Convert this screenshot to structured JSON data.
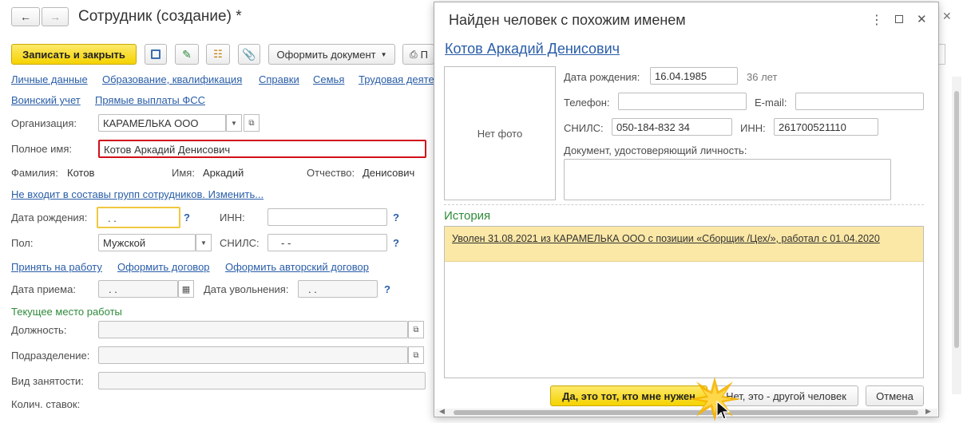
{
  "window": {
    "title": "Сотрудник (создание) *",
    "close_glyph": "✕"
  },
  "toolbar": {
    "save_close": "Записать и закрыть",
    "document": "Оформить документ",
    "print_partial": "П"
  },
  "links_row1": [
    "Личные данные",
    "Образование, квалификация",
    "Справки",
    "Семья",
    "Трудовая деяте"
  ],
  "links_row2": [
    "Воинский учет",
    "Прямые выплаты ФСС"
  ],
  "org": {
    "label": "Организация:",
    "value": "КАРАМЕЛЬКА ООО"
  },
  "fullname": {
    "label": "Полное имя:",
    "value": "Котов Аркадий Денисович"
  },
  "name_parts": {
    "last_label": "Фамилия:",
    "last": "Котов",
    "first_label": "Имя:",
    "first": "Аркадий",
    "middle_label": "Отчество:",
    "middle": "Денисович"
  },
  "groups_link": "Не входит в составы групп сотрудников. Изменить...",
  "birth": {
    "label": "Дата рождения:",
    "value": " .  ."
  },
  "inn": {
    "label": "ИНН:",
    "value": ""
  },
  "gender": {
    "label": "Пол:",
    "value": "Мужской"
  },
  "snils": {
    "label": "СНИЛС:",
    "value": "-   -"
  },
  "hire_links": [
    "Принять на работу",
    "Оформить договор",
    "Оформить авторский договор"
  ],
  "hire_date": {
    "label": "Дата приема:",
    "value": " .  ."
  },
  "fire_date": {
    "label": "Дата увольнения:",
    "value": " .  ."
  },
  "current_job_title": "Текущее место работы",
  "position": {
    "label": "Должность:"
  },
  "department": {
    "label": "Подразделение:"
  },
  "employment": {
    "label": "Вид занятости:"
  },
  "rates": {
    "label": "Колич. ставок:"
  },
  "help": "?",
  "dialog": {
    "title": "Найден человек с похожим именем",
    "person_name": "Котов Аркадий Денисович",
    "no_photo": "Нет фото",
    "birth_label": "Дата рождения:",
    "birth_value": "16.04.1985",
    "age": "36 лет",
    "phone_label": "Телефон:",
    "phone_value": "",
    "email_label": "E-mail:",
    "email_value": "",
    "snils_label": "СНИЛС:",
    "snils_value": "050-184-832 34",
    "inn_label": "ИНН:",
    "inn_value": "261700521110",
    "doc_label": "Документ, удостоверяющий личность:",
    "doc_value": "",
    "history_title": "История",
    "history_items": [
      "Уволен 31.08.2021 из КАРАМЕЛЬКА ООО с позиции «Сборщик /Цех/», работал с 01.04.2020"
    ],
    "btn_yes": "Да, это тот, кто мне нужен",
    "btn_no": "Нет, это - другой человек",
    "btn_cancel": "Отмена"
  },
  "colors": {
    "accent_yellow": "#f5d300",
    "link": "#2a5ea8",
    "highlight_row": "#fbe8a6",
    "required_border": "#d0101b",
    "green": "#2f8a3a"
  }
}
